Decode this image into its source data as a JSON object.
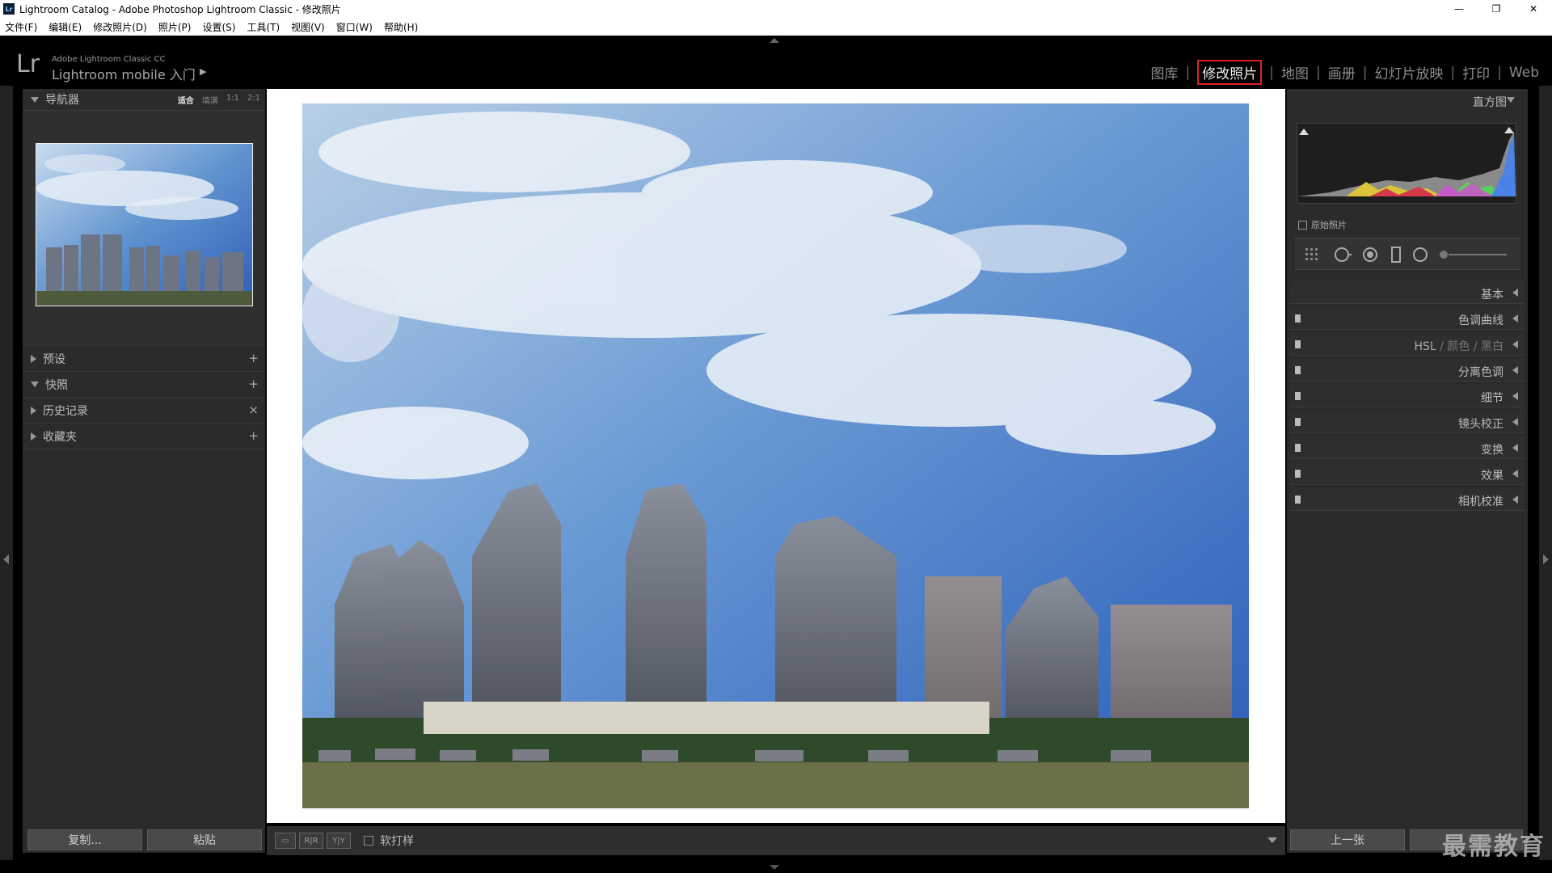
{
  "window": {
    "title": "Lightroom Catalog - Adobe Photoshop Lightroom Classic - 修改照片",
    "app_icon": "Lr",
    "controls": [
      "—",
      "❐",
      "✕"
    ]
  },
  "menu": [
    "文件(F)",
    "编辑(E)",
    "修改照片(D)",
    "照片(P)",
    "设置(S)",
    "工具(T)",
    "视图(V)",
    "窗口(W)",
    "帮助(H)"
  ],
  "identity": {
    "logo": "Lr",
    "brand_small": "Adobe Lightroom Classic CC",
    "brand_main": "Lightroom mobile 入门",
    "modules": [
      {
        "label": "图库",
        "active": false
      },
      {
        "label": "修改照片",
        "active": true
      },
      {
        "label": "地图",
        "active": false
      },
      {
        "label": "画册",
        "active": false
      },
      {
        "label": "幻灯片放映",
        "active": false
      },
      {
        "label": "打印",
        "active": false
      },
      {
        "label": "Web",
        "active": false
      }
    ]
  },
  "left_panel": {
    "navigator": {
      "title": "导航器",
      "zoom_options": [
        "适合",
        "填满",
        "1:1",
        "2:1"
      ],
      "active_zoom": "适合"
    },
    "sections": [
      {
        "label": "预设",
        "action": "+",
        "expanded": false
      },
      {
        "label": "快照",
        "action": "+",
        "expanded": true
      },
      {
        "label": "历史记录",
        "action": "×",
        "expanded": false
      },
      {
        "label": "收藏夹",
        "action": "+",
        "expanded": false
      }
    ],
    "copy_button": "复制...",
    "paste_button": "粘贴"
  },
  "toolbar": {
    "softproof_label": "软打样"
  },
  "right_panel": {
    "histogram_title": "直方图",
    "original_photo_label": "原始照片",
    "sections": [
      {
        "label": "基本"
      },
      {
        "label": "色调曲线"
      },
      {
        "label": "分离色调"
      },
      {
        "label": "细节"
      },
      {
        "label": "镜头校正"
      },
      {
        "label": "变换"
      },
      {
        "label": "效果"
      },
      {
        "label": "相机校准"
      }
    ],
    "hsl": {
      "a": "HSL",
      "sep": "/",
      "b": "颜色",
      "c": "黑白"
    },
    "prev_button": "上一张"
  },
  "watermark": "最需教育"
}
